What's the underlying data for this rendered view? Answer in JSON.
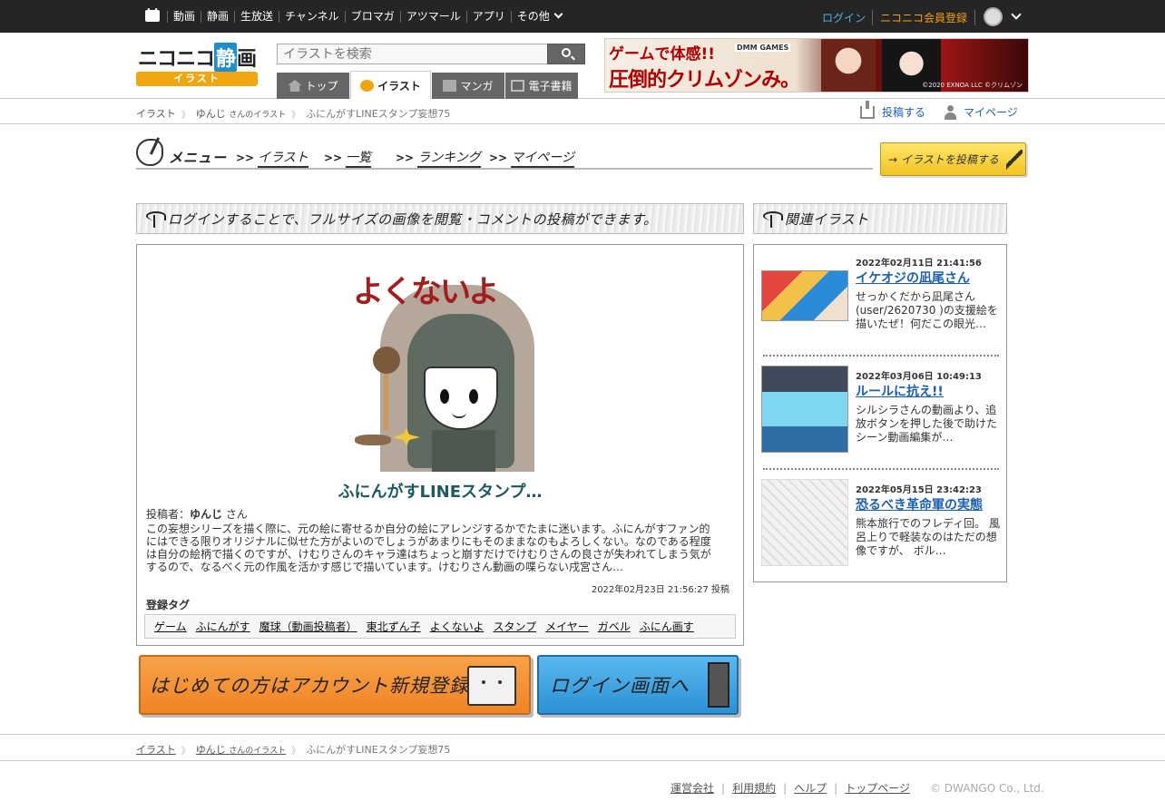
{
  "global_nav": {
    "items": [
      {
        "label": "動画"
      },
      {
        "label": "静画"
      },
      {
        "label": "生放送"
      },
      {
        "label": "チャンネル"
      },
      {
        "label": "ブロマガ"
      },
      {
        "label": "アツマール"
      },
      {
        "label": "アプリ"
      },
      {
        "label": "その他"
      }
    ],
    "login_label": "ログイン",
    "register_label": "ニコニコ会員登録"
  },
  "logo": {
    "main": "ニコニコ",
    "highlight": "静",
    "tail": "画",
    "sub": "イラスト"
  },
  "search": {
    "placeholder": "イラストを検索"
  },
  "tabs": [
    {
      "label": "トップ",
      "icon": "home-icon",
      "active": false
    },
    {
      "label": "イラスト",
      "icon": "palette-icon",
      "active": true
    },
    {
      "label": "マンガ",
      "icon": "manga-icon",
      "active": false
    },
    {
      "label": "電子書籍",
      "icon": "book-icon",
      "active": false
    }
  ],
  "banner": {
    "line1": "ゲームで体感!!",
    "line2": "圧倒的クリムゾンみ。",
    "brand": "DMM GAMES",
    "copyright": "©2020 EXNOA LLC ©クリムゾン"
  },
  "breadcrumb": {
    "root": "イラスト",
    "user": "ゆんじ",
    "user_suffix": "さんのイラスト",
    "current": "ふにんがすLINEスタンプ妄想75"
  },
  "actions": {
    "post_label": "投稿する",
    "mypage_label": "マイページ"
  },
  "menu": {
    "title": "メニュー",
    "arrow": ">>",
    "links": [
      "イラスト",
      "一覧",
      "ランキング",
      "マイページ"
    ],
    "post_button": "イラストを投稿する"
  },
  "main": {
    "notice": "ログインすることで、フルサイズの画像を閲覧・コメントの投稿ができます。",
    "illust_caption": "よくないよ",
    "title": "ふにんがすLINEスタンプ…",
    "author_prefix": "投稿者：",
    "author": "ゆんじ",
    "author_suffix": "さん",
    "description": "この妄想シリーズを描く際に、元の絵に寄せるか自分の絵にアレンジするかでたまに迷います。ふにんがすファン的にはできる限りオリジナルに似せた方がよいのでしょうがあまりにもそのままなのもよろしくない。なのである程度は自分の絵柄で描くのですが、けむりさんのキャラ達はちょっと崩すだけでけむりさんの良さが失われてしまう気がするので、なるべく元の作風を活かす感じで描いています。けむりさん動画の喋らない戌宮さん…",
    "post_date": "2022年02月23日 21:56:27 投稿",
    "tags_label": "登録タグ",
    "tags": [
      "ゲーム",
      "ふにんがす",
      "魔球（動画投稿者）",
      "東北ずん子",
      "よくないよ",
      "スタンプ",
      "メイヤー",
      "ガベル",
      "ふにん画す"
    ]
  },
  "cta": {
    "register": "はじめての方はアカウント新規登録へ",
    "login": "ログイン画面へ"
  },
  "related": {
    "title": "関連イラスト",
    "items": [
      {
        "date": "2022年02月11日 21:41:56",
        "title": "イケオジの凪尾さん",
        "desc": "せっかくだから凪尾さん(user/2620730 )の支援絵を描いたぜ！何だこの眼光…"
      },
      {
        "date": "2022年03月06日 10:49:13",
        "title": "ルールに抗え!!",
        "desc": "シルシラさんの動画より、追放ボタンを押した後で助けたシーン動画編集が…"
      },
      {
        "date": "2022年05月15日 23:42:23",
        "title": "恐るべき革命軍の実態",
        "desc": "熊本旅行でのフレディ回。 風呂上りで軽装なのはただの想像ですが、 ボル…"
      }
    ]
  },
  "footer": {
    "links": [
      "運営会社",
      "利用規約",
      "ヘルプ",
      "トップページ"
    ],
    "copyright": "© DWANGO Co., Ltd."
  }
}
